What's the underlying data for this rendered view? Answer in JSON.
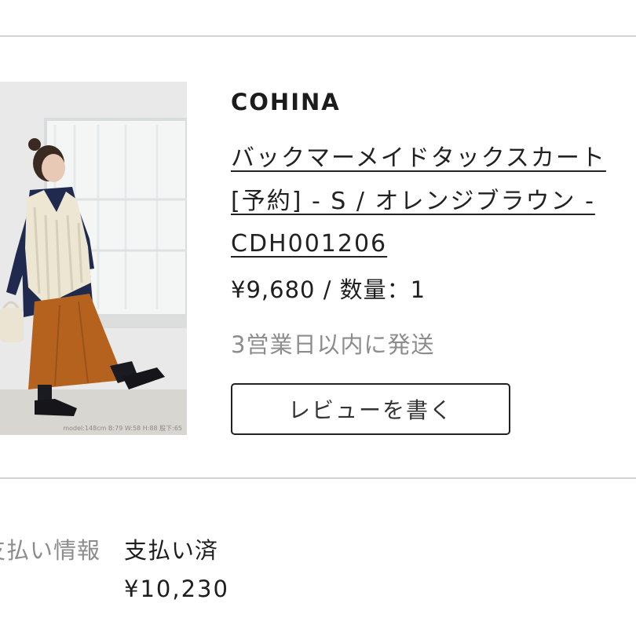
{
  "order_item": {
    "brand": "COHINA",
    "title_lines": [
      "バックマーメイドタックスカート",
      "[予約] - S / オレンジブラウン -",
      "CDH001206"
    ],
    "price_quantity": "¥9,680 / 数量：1",
    "shipping_note": "3営業日以内に発送",
    "review_button_label": "レビューを書く",
    "photo": {
      "caption": "model:148cm B:79 W:58 H:88 股下:65"
    }
  },
  "payment": {
    "label": "支払い情報",
    "status": "支払い済",
    "total": "¥10,230"
  },
  "colors": {
    "divider": "#d2d2d2",
    "text": "#222222",
    "muted_text": "#8c8c8c",
    "skirt": "#b5621f",
    "shirt": "#1f2a4e",
    "vest": "#ece6d3"
  }
}
